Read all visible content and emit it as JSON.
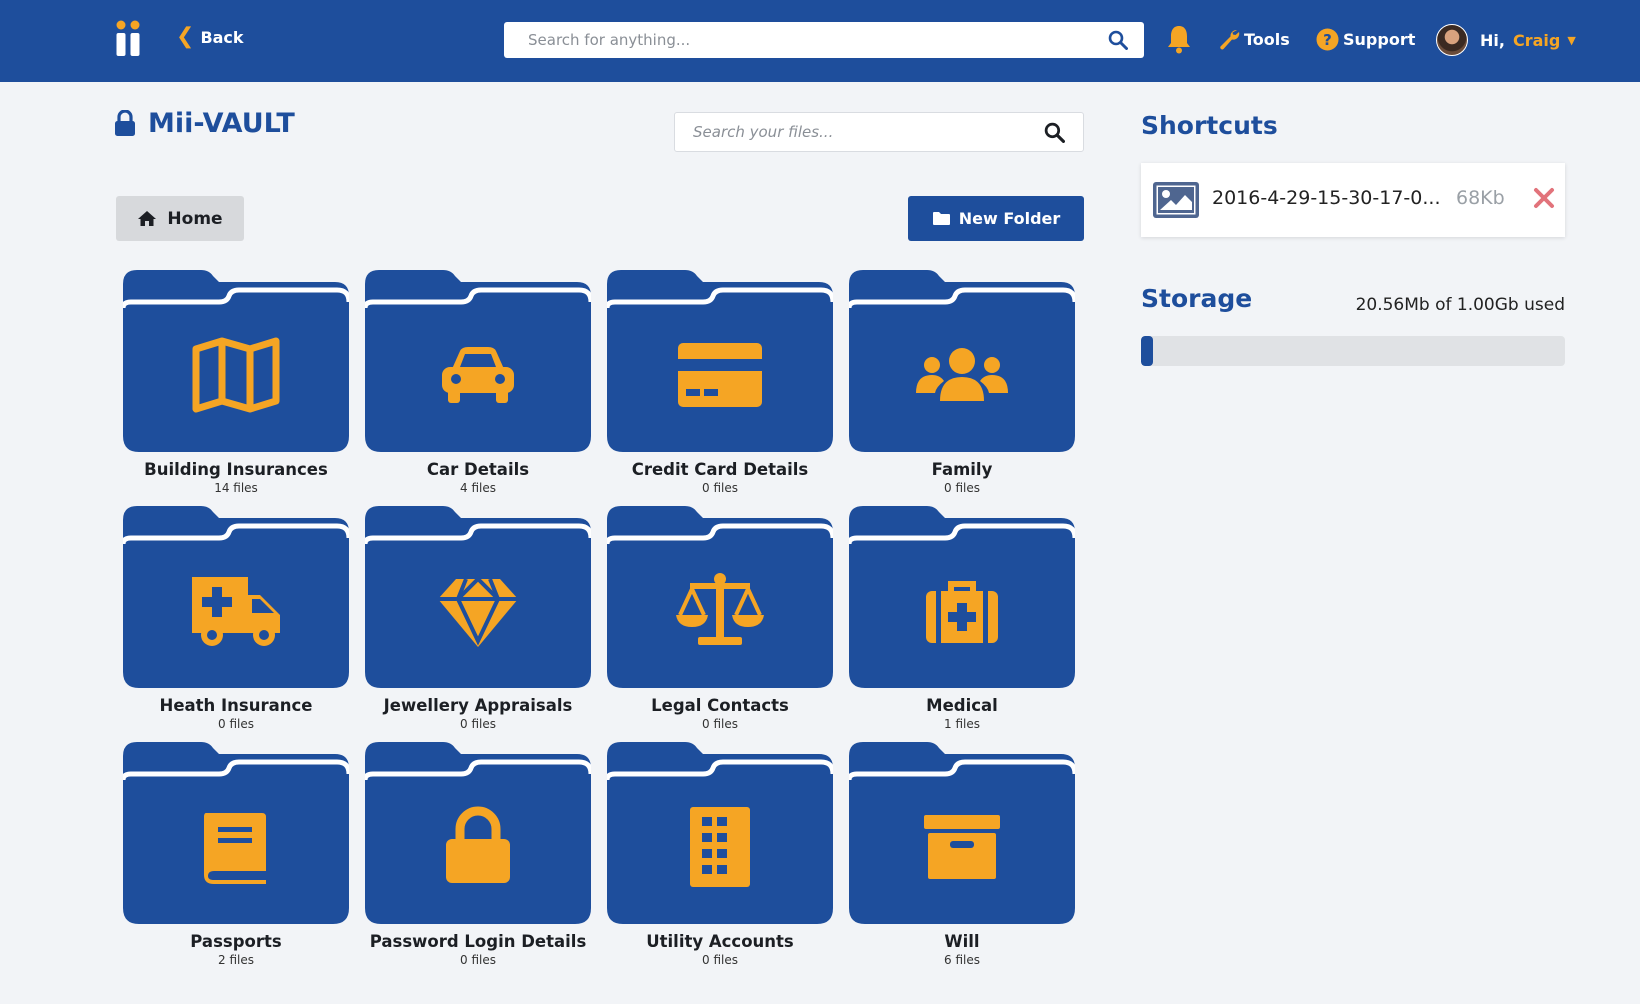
{
  "navbar": {
    "back_label": "Back",
    "search_placeholder": "Search for anything...",
    "tools_label": "Tools",
    "support_label": "Support",
    "greeting": "Hi,",
    "user_name": "Craig"
  },
  "vault": {
    "title": "Mii-VAULT",
    "file_search_placeholder": "Search your files...",
    "home_label": "Home",
    "new_folder_label": "New Folder"
  },
  "folders": [
    {
      "name": "Building Insurances",
      "count": "14 files",
      "icon": "map-icon"
    },
    {
      "name": "Car Details",
      "count": "4 files",
      "icon": "car-icon"
    },
    {
      "name": "Credit Card Details",
      "count": "0 files",
      "icon": "credit-card-icon"
    },
    {
      "name": "Family",
      "count": "0 files",
      "icon": "users-icon"
    },
    {
      "name": "Heath Insurance",
      "count": "0 files",
      "icon": "ambulance-icon"
    },
    {
      "name": "Jewellery Appraisals",
      "count": "0 files",
      "icon": "diamond-icon"
    },
    {
      "name": "Legal Contacts",
      "count": "0 files",
      "icon": "balance-scale-icon"
    },
    {
      "name": "Medical",
      "count": "1 files",
      "icon": "medkit-icon"
    },
    {
      "name": "Passports",
      "count": "2 files",
      "icon": "book-icon"
    },
    {
      "name": "Password Login Details",
      "count": "0 files",
      "icon": "lock-icon"
    },
    {
      "name": "Utility Accounts",
      "count": "0 files",
      "icon": "building-icon"
    },
    {
      "name": "Will",
      "count": "6 files",
      "icon": "archive-box-icon"
    }
  ],
  "shortcuts": {
    "title": "Shortcuts",
    "items": [
      {
        "name": "2016-4-29-15-30-17-0...",
        "size": "68Kb",
        "icon": "image-icon"
      }
    ]
  },
  "storage": {
    "title": "Storage",
    "used_text": "20.56Mb of 1.00Gb used",
    "used_fraction": 0.02
  },
  "colors": {
    "brand_blue": "#1e4e9c",
    "accent_orange": "#f5a524",
    "remove_red": "#e2737b"
  }
}
